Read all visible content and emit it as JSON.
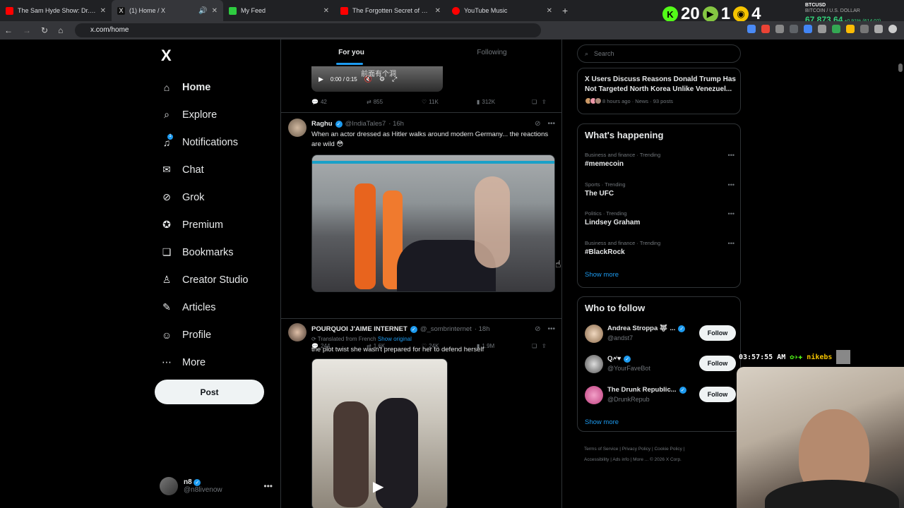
{
  "browser": {
    "tabs": [
      {
        "title": "The Sam Hyde Show: Dr. Seuss",
        "color": "#ff0000"
      },
      {
        "title": "(1) Home / X",
        "color": "#ffffff"
      },
      {
        "title": "My Feed",
        "color": "#2ecc40"
      },
      {
        "title": "The Forgotten Secret of Europe",
        "color": "#ff0000"
      },
      {
        "title": "YouTube Music",
        "color": "#ff0000"
      }
    ],
    "url": "x.com/home",
    "ticker": {
      "v1": "20",
      "v2": "1",
      "v3": "4"
    },
    "btc": {
      "label": "BTCUSD",
      "sub": "BITCOIN / U.S. DOLLAR",
      "price": "67,873.64",
      "change": "+0.91% (614.02)"
    }
  },
  "nav": {
    "logo": "X",
    "items": [
      {
        "label": "Home",
        "icon": "home-icon",
        "glyph": "⌂"
      },
      {
        "label": "Explore",
        "icon": "search-icon",
        "glyph": "⌕"
      },
      {
        "label": "Notifications",
        "icon": "bell-icon",
        "glyph": "♫"
      },
      {
        "label": "Chat",
        "icon": "mail-icon",
        "glyph": "✉"
      },
      {
        "label": "Grok",
        "icon": "grok-icon",
        "glyph": "⊘"
      },
      {
        "label": "Premium",
        "icon": "premium-icon",
        "glyph": "✪"
      },
      {
        "label": "Bookmarks",
        "icon": "bookmark-icon",
        "glyph": "❏"
      },
      {
        "label": "Creator Studio",
        "icon": "flask-icon",
        "glyph": "♙"
      },
      {
        "label": "Articles",
        "icon": "article-icon",
        "glyph": "✎"
      },
      {
        "label": "Profile",
        "icon": "person-icon",
        "glyph": "☺"
      },
      {
        "label": "More",
        "icon": "more-icon",
        "glyph": "⋯"
      }
    ],
    "notifications_badge": "1",
    "post_label": "Post",
    "account": {
      "name": "n8",
      "handle": "@n8livenow"
    }
  },
  "feed": {
    "tabs": [
      "For you",
      "Following"
    ],
    "top_video": {
      "caption": "前面有个洞",
      "time": "0:00 / 0:15"
    },
    "top_actions": {
      "replies": "42",
      "reposts": "855",
      "likes": "11K",
      "views": "312K"
    },
    "tweets": [
      {
        "name": "Raghu",
        "handle": "@IndiaTales7",
        "time": "· 16h",
        "text": "When an actor dressed as Hitler walks around modern Germany... the reactions are wild 😳",
        "replies": "244",
        "reposts": "1.6K",
        "likes": "24K",
        "views": "1.9M"
      },
      {
        "name": "POURQUOI J'AIME INTERNET",
        "handle": "@_sombrinternet",
        "time": "· 18h",
        "translated": "Translated from French",
        "show_original": "Show original",
        "text": "the plot twist she wasn't prepared for her to defend herself"
      }
    ]
  },
  "sidebar": {
    "search_placeholder": "Search",
    "news": {
      "title": "X Users Discuss Reasons Donald Trump Has Not Targeted North Korea Unlike Venezuel...",
      "meta": "8 hours ago · News · 93 posts"
    },
    "happening": {
      "title": "What's happening",
      "trends": [
        {
          "category": "Business and finance · Trending",
          "name": "#memecoin"
        },
        {
          "category": "Sports · Trending",
          "name": "The UFC"
        },
        {
          "category": "Politics · Trending",
          "name": "Lindsey Graham"
        },
        {
          "category": "Business and finance · Trending",
          "name": "#BlackRock"
        }
      ],
      "show_more": "Show more"
    },
    "who_to_follow": {
      "title": "Who to follow",
      "accounts": [
        {
          "name": "Andrea Stroppa 🐺 ...",
          "handle": "@andst7"
        },
        {
          "name": "Q🗲♥",
          "handle": "@YourFaveBot"
        },
        {
          "name": "The Drunk Republic...",
          "handle": "@DrunkRepub"
        }
      ],
      "follow_label": "Follow",
      "show_more": "Show more"
    },
    "footer": {
      "line1": "Terms of Service  |  Privacy Policy  |  Cookie Policy  |",
      "line2": "Accessibility  |  Ads info  |  More ...  © 2026 X Corp."
    }
  },
  "overlay": {
    "clock": "03:57:55 AM",
    "chat_name": "nikebs"
  }
}
